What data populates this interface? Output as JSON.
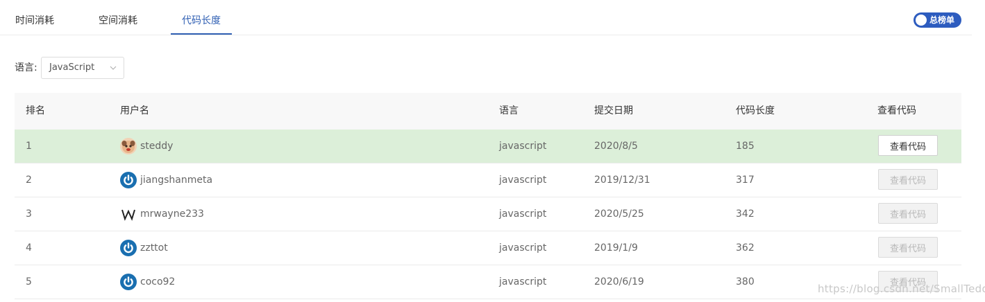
{
  "tabs": [
    {
      "label": "时间消耗",
      "active": false
    },
    {
      "label": "空间消耗",
      "active": false
    },
    {
      "label": "代码长度",
      "active": true
    }
  ],
  "toggle": {
    "label": "总榜单",
    "on": true
  },
  "filter": {
    "label": "语言:",
    "value": "JavaScript"
  },
  "table": {
    "headers": [
      "排名",
      "用户名",
      "语言",
      "提交日期",
      "代码长度",
      "查看代码"
    ],
    "rows": [
      {
        "rank": "1",
        "avatar": "cartoon-face-avatar",
        "user": "steddy",
        "lang": "javascript",
        "date": "2020/8/5",
        "length": "185",
        "button": "查看代码",
        "enabled": true,
        "highlight": true
      },
      {
        "rank": "2",
        "avatar": "power-icon-avatar",
        "user": "jiangshanmeta",
        "lang": "javascript",
        "date": "2019/12/31",
        "length": "317",
        "button": "查看代码",
        "enabled": false,
        "highlight": false
      },
      {
        "rank": "3",
        "avatar": "w-letter-avatar",
        "user": "mrwayne233",
        "lang": "javascript",
        "date": "2020/5/25",
        "length": "342",
        "button": "查看代码",
        "enabled": false,
        "highlight": false
      },
      {
        "rank": "4",
        "avatar": "power-icon-avatar",
        "user": "zzttot",
        "lang": "javascript",
        "date": "2019/1/9",
        "length": "362",
        "button": "查看代码",
        "enabled": false,
        "highlight": false
      },
      {
        "rank": "5",
        "avatar": "power-icon-avatar",
        "user": "coco92",
        "lang": "javascript",
        "date": "2020/6/19",
        "length": "380",
        "button": "查看代码",
        "enabled": false,
        "highlight": false
      }
    ]
  },
  "watermark": "https://blog.csdn.net/SmallTeddy",
  "colors": {
    "accent": "#2f5fb3",
    "toggle": "#2d5cbf",
    "highlight_row": "#dcefd9",
    "avatar_blue": "#1a6fb0"
  }
}
